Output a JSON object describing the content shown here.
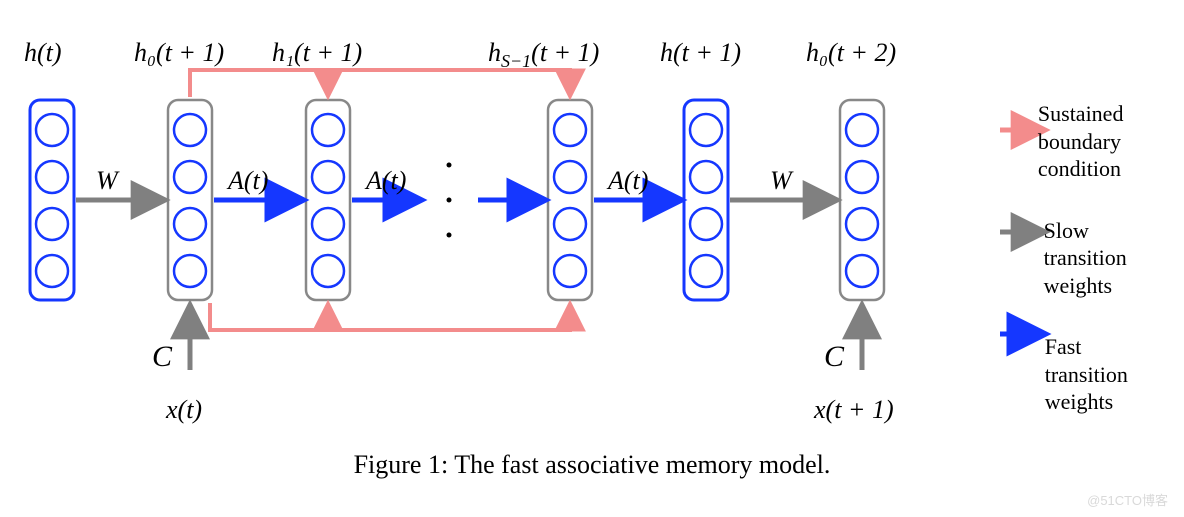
{
  "labels": {
    "col1": "h(t)",
    "col2": "h₀(t + 1)",
    "col3": "h₁(t + 1)",
    "col4": "h",
    "col4_sub": "S−1",
    "col4_tail": "(t + 1)",
    "col5": "h(t + 1)",
    "col6": "h₀(t + 2)",
    "w1": "W",
    "w2": "W",
    "a1": "A(t)",
    "a2": "A(t)",
    "a3": "A(t)",
    "c1": "C",
    "c2": "C",
    "x1": "x(t)",
    "x2": "x(t + 1)"
  },
  "dots": "·",
  "legend": {
    "sustained": "Sustained boundary condition",
    "slow": "Slow transition weights",
    "fast": "Fast transition weights"
  },
  "caption": "Figure 1:  The fast associative memory model.",
  "watermark": "@51CTO博客",
  "colors": {
    "blue": "#1537ff",
    "salmon": "#f38c8c",
    "gray": "#808080",
    "node_stroke": "#888888"
  }
}
